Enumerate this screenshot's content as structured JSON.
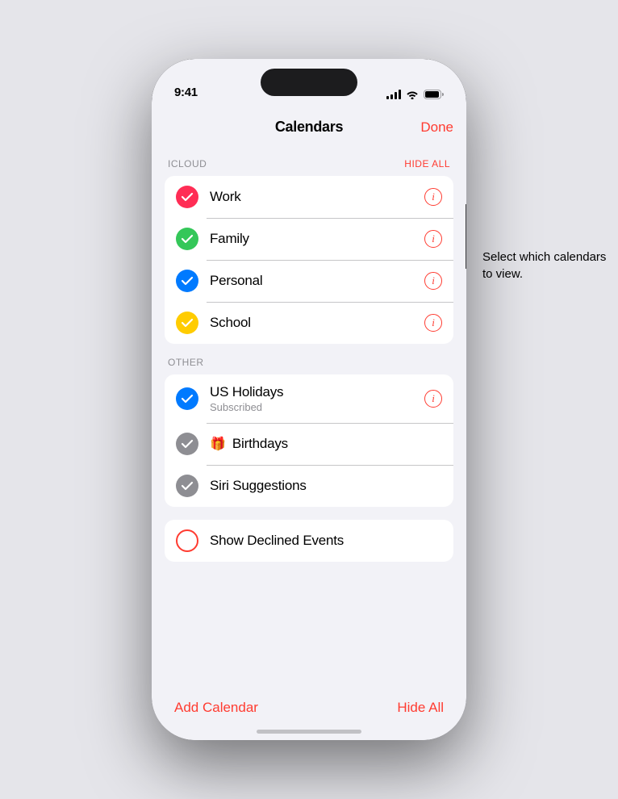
{
  "statusBar": {
    "time": "9:41"
  },
  "header": {
    "title": "Calendars",
    "doneLabel": "Done"
  },
  "icloud": {
    "sectionLabel": "ICLOUD",
    "hideAllLabel": "HIDE ALL",
    "calendars": [
      {
        "name": "Work",
        "color": "#ff2d55",
        "checked": true,
        "showInfo": true
      },
      {
        "name": "Family",
        "color": "#34c759",
        "checked": true,
        "showInfo": true
      },
      {
        "name": "Personal",
        "color": "#007aff",
        "checked": true,
        "showInfo": true
      },
      {
        "name": "School",
        "color": "#ffcc00",
        "checked": true,
        "showInfo": true
      }
    ]
  },
  "other": {
    "sectionLabel": "OTHER",
    "calendars": [
      {
        "name": "US Holidays",
        "subtitle": "Subscribed",
        "color": "#007aff",
        "checked": true,
        "showInfo": true,
        "hasGift": false
      },
      {
        "name": "Birthdays",
        "color": "#8e8e93",
        "checked": true,
        "showInfo": false,
        "hasGift": true
      },
      {
        "name": "Siri Suggestions",
        "color": "#8e8e93",
        "checked": true,
        "showInfo": false,
        "hasGift": false
      }
    ]
  },
  "showDeclined": {
    "label": "Show Declined Events",
    "checked": false
  },
  "bottomBar": {
    "addLabel": "Add Calendar",
    "hideLabel": "Hide All"
  },
  "tooltip": {
    "text": "Select which calendars to view."
  }
}
